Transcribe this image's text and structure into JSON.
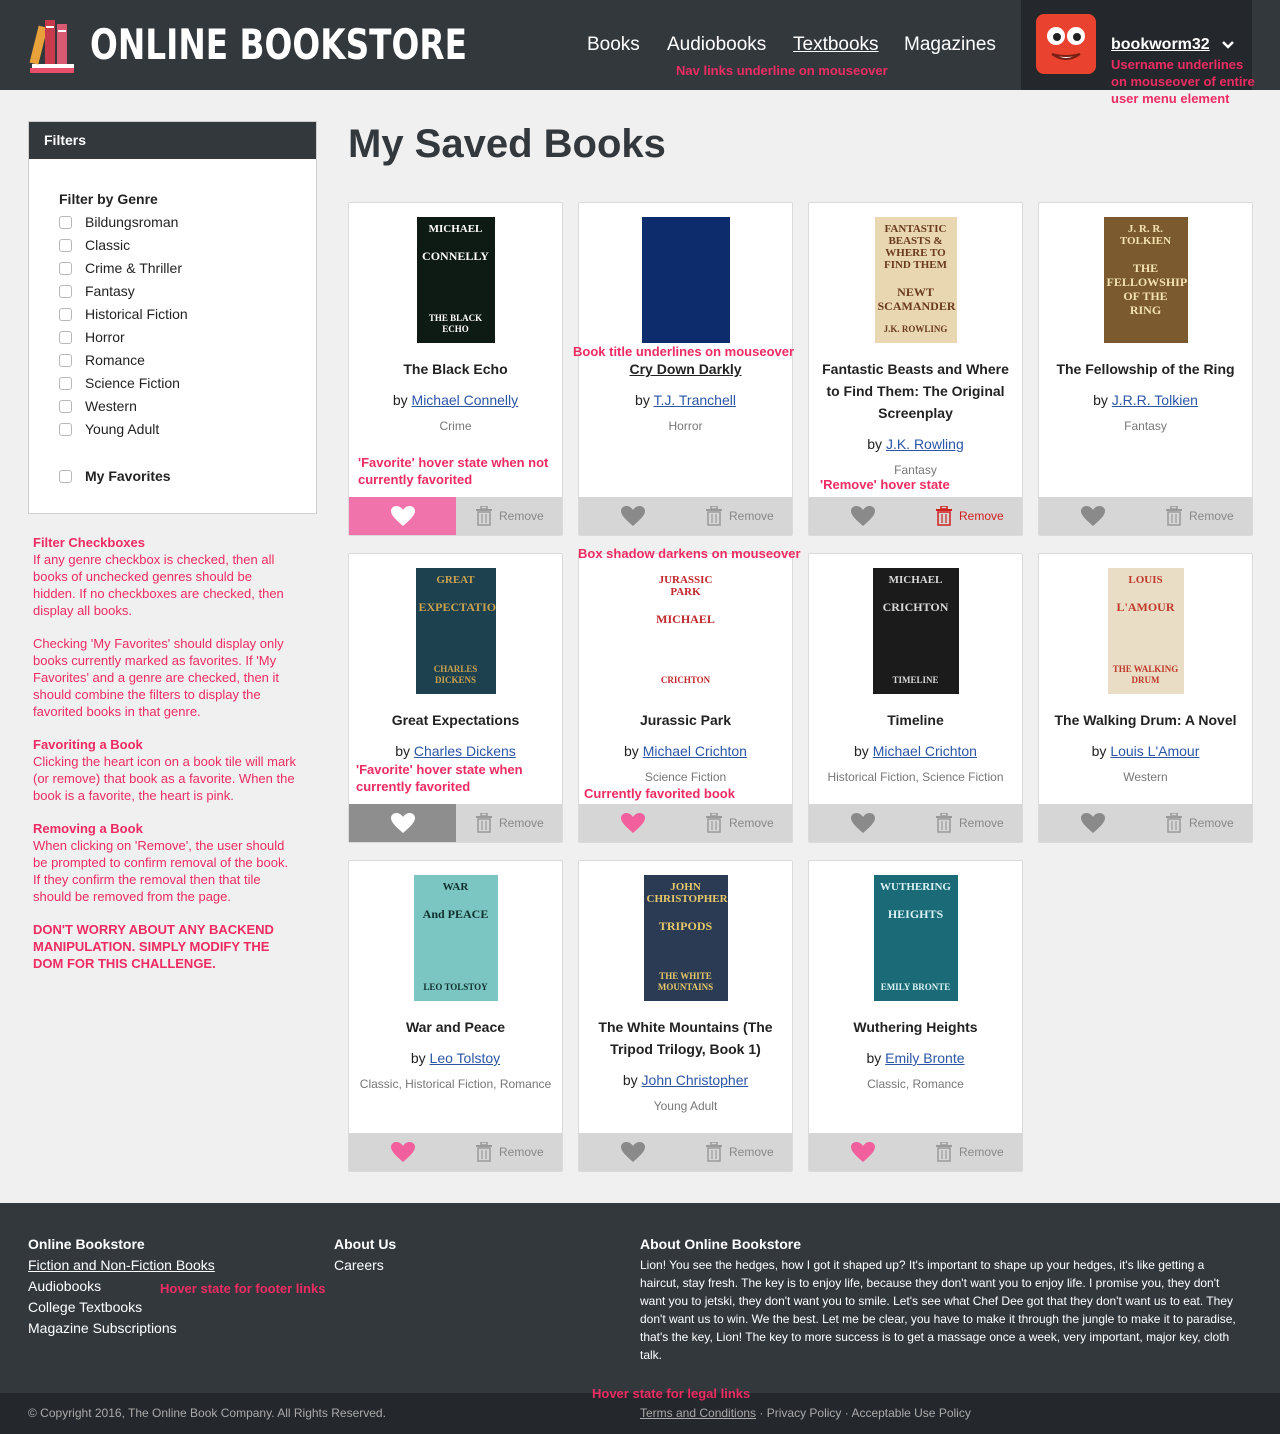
{
  "header": {
    "logo_text": "ONLINE BOOKSTORE",
    "nav": [
      "Books",
      "Audiobooks",
      "Textbooks",
      "Magazines"
    ],
    "username": "bookworm32"
  },
  "annotations": {
    "nav": "Nav links underline on mouseover",
    "username": [
      "Username underlines",
      "on mouseover of entire",
      "user menu element"
    ],
    "book_title": "Book title underlines on mouseover",
    "fav_hover_not": [
      "'Favorite' hover state when not",
      "currently favorited"
    ],
    "remove_hover": "'Remove' hover state",
    "box_shadow": "Box shadow darkens on mouseover",
    "fav_hover_current": [
      "'Favorite' hover state when",
      "currently favorited"
    ],
    "currently_fav": "Currently favorited book",
    "footer_hover": "Hover state for footer links",
    "legal_hover": "Hover state for legal links",
    "notes": {
      "filter_title": "Filter Checkboxes",
      "filter_body": [
        "If any genre checkbox is checked, then all",
        "books of unchecked genres should be",
        "hidden. If no checkboxes are checked, then",
        "display all books."
      ],
      "fav_filter_body": [
        "Checking 'My Favorites' should display only",
        "books currently marked as favorites. If 'My",
        "Favorites' and a genre are checked, then it",
        "should combine the filters to display the",
        "favorited books in that genre."
      ],
      "favoriting_title": "Favoriting a Book",
      "favoriting_body": [
        "Clicking the heart icon on a book tile will mark",
        "(or remove) that book as a favorite. When the",
        "book is a favorite, the heart is pink."
      ],
      "removing_title": "Removing a Book",
      "removing_body": [
        "When clicking on 'Remove', the user should",
        "be prompted to confirm removal of the book.",
        "If they confirm the removal then that tile",
        "should be removed from the page."
      ],
      "dont_worry": [
        "DON'T WORRY ABOUT ANY BACKEND",
        "MANIPULATION. SIMPLY MODIFY THE",
        "DOM FOR THIS CHALLENGE."
      ]
    }
  },
  "filters": {
    "header": "Filters",
    "genre_title": "Filter by Genre",
    "genres": [
      "Bildungsroman",
      "Classic",
      "Crime & Thriller",
      "Fantasy",
      "Historical Fiction",
      "Horror",
      "Romance",
      "Science Fiction",
      "Western",
      "Young Adult"
    ],
    "favorites_label": "My Favorites"
  },
  "main": {
    "title": "My Saved Books",
    "remove_label": "Remove",
    "by": "by",
    "books": [
      {
        "title": "The Black Echo",
        "author": "Michael Connelly",
        "genres": "Crime",
        "favorite": false
      },
      {
        "title": "Cry Down Darkly",
        "author": "T.J. Tranchell",
        "genres": "Horror",
        "favorite": false
      },
      {
        "title": "Fantastic Beasts and Where to Find Them: The Original Screenplay",
        "author": "J.K. Rowling",
        "genres": "Fantasy",
        "favorite": false
      },
      {
        "title": "The Fellowship of the Ring",
        "author": "J.R.R. Tolkien",
        "genres": "Fantasy",
        "favorite": false
      },
      {
        "title": "Great Expectations",
        "author": "Charles Dickens",
        "genres": "",
        "favorite": true
      },
      {
        "title": "Jurassic Park",
        "author": "Michael Crichton",
        "genres": "Science Fiction",
        "favorite": true
      },
      {
        "title": "Timeline",
        "author": "Michael Crichton",
        "genres": "Historical Fiction, Science Fiction",
        "favorite": false
      },
      {
        "title": "The Walking Drum: A Novel",
        "author": "Louis L'Amour",
        "genres": "Western",
        "favorite": false
      },
      {
        "title": "War and Peace",
        "author": "Leo Tolstoy",
        "genres": "Classic, Historical Fiction, Romance",
        "favorite": true
      },
      {
        "title": "The White Mountains (The Tripod Trilogy, Book 1)",
        "author": "John Christopher",
        "genres": "Young Adult",
        "favorite": false
      },
      {
        "title": "Wuthering Heights",
        "author": "Emily Bronte",
        "genres": "Classic, Romance",
        "favorite": true
      }
    ],
    "covers": [
      {
        "top": "MICHAEL",
        "mid": "CONNELLY",
        "bottom": "THE BLACK ECHO"
      },
      {
        "top": "",
        "mid": "",
        "bottom": ""
      },
      {
        "top": "FANTASTIC BEASTS & WHERE TO FIND THEM",
        "mid": "NEWT SCAMANDER",
        "bottom": "J.K. ROWLING"
      },
      {
        "top": "J. R. R. TOLKIEN",
        "mid": "THE FELLOWSHIP OF THE RING",
        "bottom": ""
      },
      {
        "top": "GREAT",
        "mid": "EXPECTATIONS",
        "bottom": "CHARLES DICKENS"
      },
      {
        "top": "JURASSIC PARK",
        "mid": "MICHAEL",
        "bottom": "CRICHTON"
      },
      {
        "top": "MICHAEL",
        "mid": "CRICHTON",
        "bottom": "TIMELINE"
      },
      {
        "top": "LOUIS",
        "mid": "L'AMOUR",
        "bottom": "THE WALKING DRUM"
      },
      {
        "top": "WAR",
        "mid": "And PEACE",
        "bottom": "LEO TOLSTOY"
      },
      {
        "top": "JOHN CHRISTOPHER",
        "mid": "TRIPODS",
        "bottom": "THE WHITE MOUNTAINS"
      },
      {
        "top": "WUTHERING",
        "mid": "HEIGHTS",
        "bottom": "EMILY BRONTE"
      }
    ]
  },
  "footer": {
    "col1_title": "Online Bookstore",
    "col1_links": [
      "Fiction and Non-Fiction Books",
      "Audiobooks",
      "College Textbooks",
      "Magazine Subscriptions"
    ],
    "col2_title": "About Us",
    "col2_links": [
      "Careers"
    ],
    "col3_title": "About Online Bookstore",
    "col3_text": "Lion! You see the hedges, how I got it shaped up? It's important to shape up your hedges, it's like getting a haircut, stay fresh. The key is to enjoy life, because they don't want you to enjoy life. I promise you, they don't want you to jetski, they don't want you to smile. Let's see what Chef Dee got that they don't want us to eat. They don't want us to win. We the best. Let me be clear, you have to make it through the jungle to make it to paradise, that's the key, Lion! The key to more success is to get a massage once a week, very important, major key, cloth talk.",
    "copyright": "© Copyright 2016, The Online Book Company. All Rights Reserved.",
    "legal_links": [
      "Terms and Conditions",
      "Privacy Policy",
      "Acceptable Use Policy"
    ],
    "legal_sep": " · "
  },
  "colors": {
    "accent": "#ee2b62",
    "pink": "#f173ac",
    "dark": "#33383d",
    "link": "#2b56a6"
  }
}
